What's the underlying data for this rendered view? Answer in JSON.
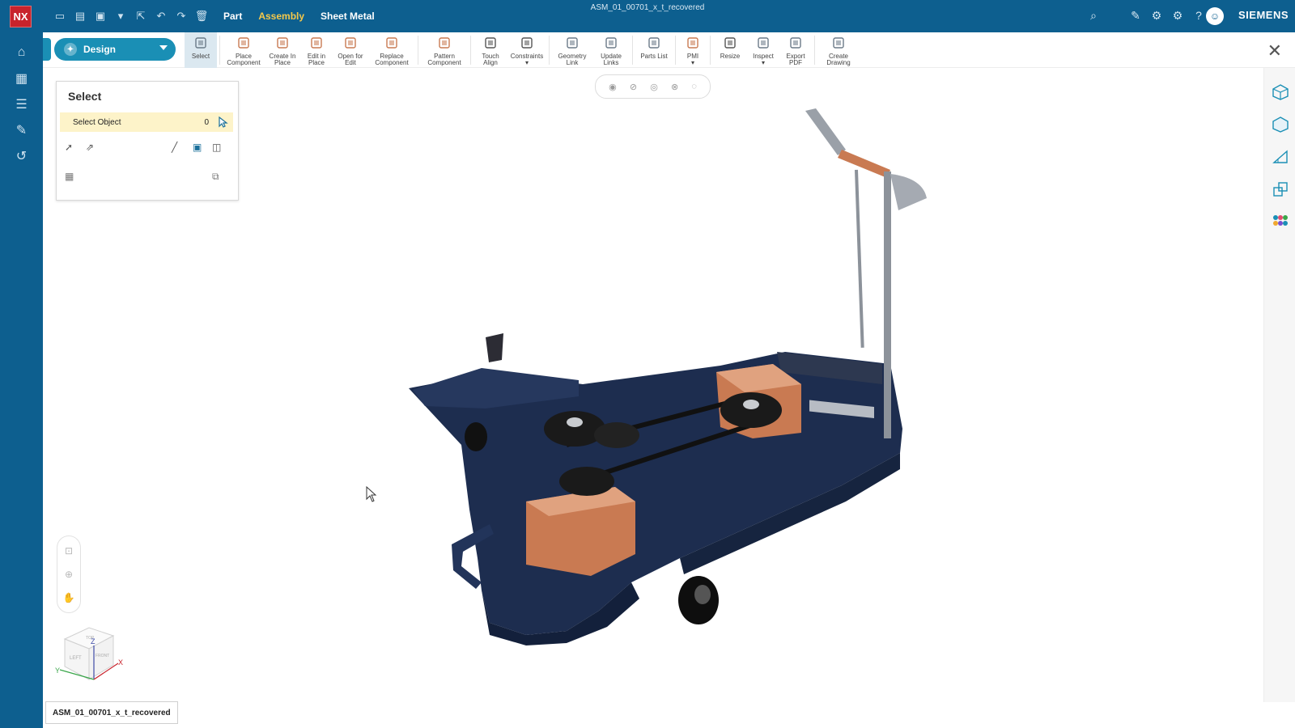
{
  "app": {
    "logo": "NX",
    "document_title": "ASM_01_00701_x_t_recovered",
    "brand": "SIEMENS"
  },
  "menu_tabs": [
    {
      "label": "Part"
    },
    {
      "label": "Assembly"
    },
    {
      "label": "Sheet Metal"
    }
  ],
  "app_switcher": {
    "label": "Design"
  },
  "ribbon": [
    {
      "line1": "Select",
      "line2": "",
      "icon": "select-arrow-icon"
    },
    {
      "line1": "Place",
      "line2": "Component",
      "icon": "place-component-icon"
    },
    {
      "line1": "Create In",
      "line2": "Place",
      "icon": "create-in-place-icon"
    },
    {
      "line1": "Edit in",
      "line2": "Place",
      "icon": "edit-in-place-icon"
    },
    {
      "line1": "Open for",
      "line2": "Edit",
      "icon": "open-for-edit-icon"
    },
    {
      "line1": "Replace",
      "line2": "Component",
      "icon": "replace-component-icon"
    },
    {
      "line1": "Pattern",
      "line2": "Component",
      "icon": "pattern-component-icon"
    },
    {
      "line1": "Touch",
      "line2": "Align",
      "icon": "touch-align-icon"
    },
    {
      "line1": "Constraints",
      "line2": "▾",
      "icon": "constraints-icon"
    },
    {
      "line1": "Geometry",
      "line2": "Link",
      "icon": "geometry-link-icon"
    },
    {
      "line1": "Update",
      "line2": "Links",
      "icon": "update-links-icon"
    },
    {
      "line1": "Parts List",
      "line2": "",
      "icon": "parts-list-icon"
    },
    {
      "line1": "PMI",
      "line2": "▾",
      "icon": "pmi-icon"
    },
    {
      "line1": "Resize",
      "line2": "",
      "icon": "resize-icon"
    },
    {
      "line1": "Inspect",
      "line2": "▾",
      "icon": "inspect-icon"
    },
    {
      "line1": "Export",
      "line2": "PDF",
      "icon": "export-pdf-icon"
    },
    {
      "line1": "Create",
      "line2": "Drawing",
      "icon": "create-drawing-icon"
    }
  ],
  "select_panel": {
    "title": "Select",
    "row_label": "Select Object",
    "count": "0"
  },
  "status_tab": {
    "label": "ASM_01_00701_x_t_recovered"
  },
  "triad": {
    "z": "Z",
    "x": "X",
    "y": "Y",
    "top": "TOP",
    "left": "LEFT",
    "front": "FRONT"
  },
  "colors": {
    "titlebar": "#0d5f8f",
    "accent": "#1a8fb5",
    "active_tab": "#f5c84a",
    "nx_logo": "#c8232c",
    "model_body": "#1d2d4f",
    "model_copper": "#c97a52"
  }
}
